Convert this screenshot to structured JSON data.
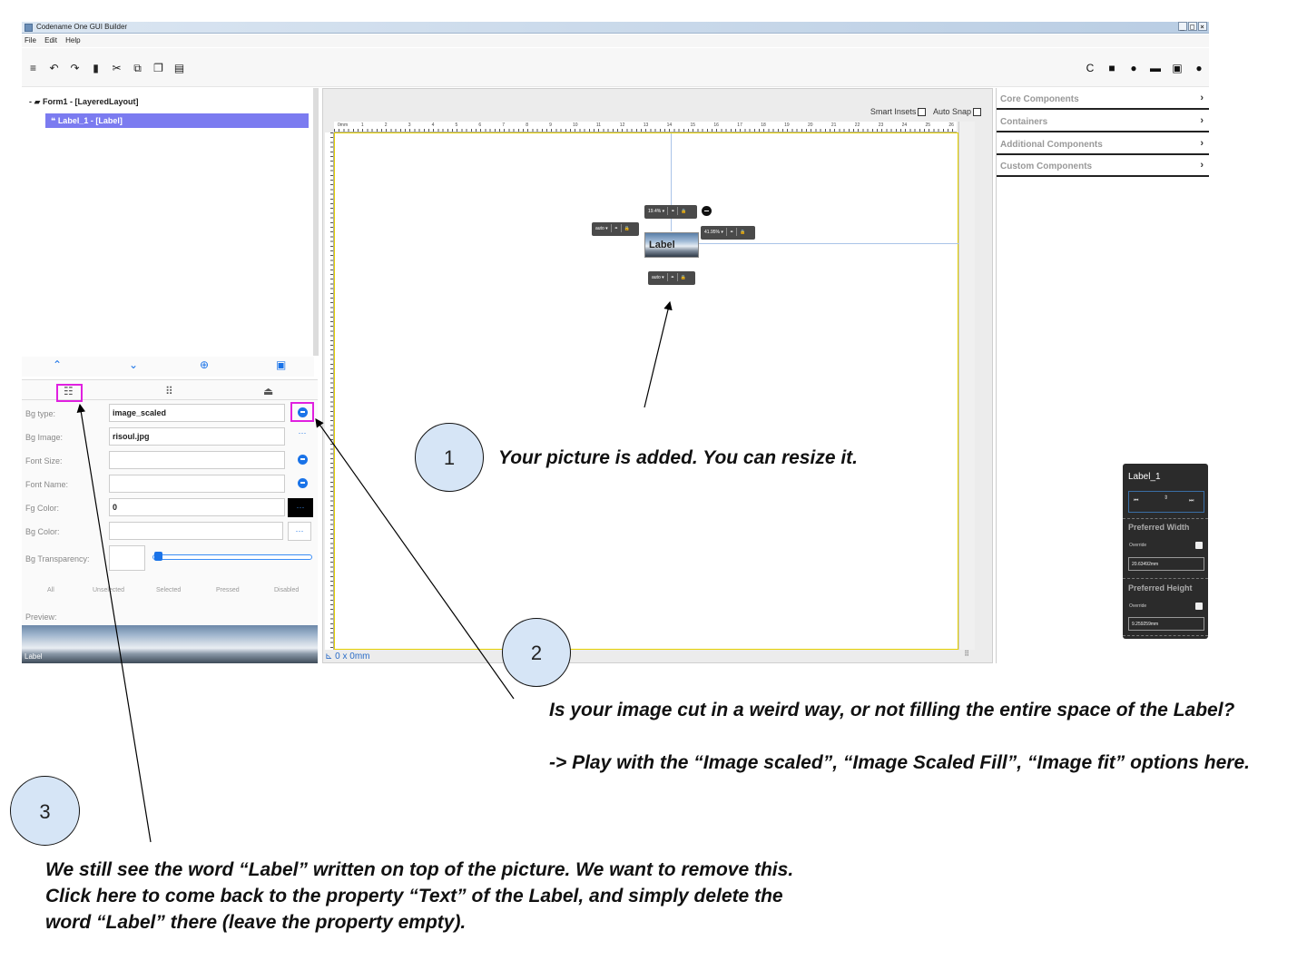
{
  "window": {
    "title": "Codename One GUI Builder",
    "controls": [
      "_",
      "□",
      "×"
    ]
  },
  "menu": [
    "File",
    "Edit",
    "Help"
  ],
  "toolbar": {
    "left_icons": [
      "menu-icon",
      "undo-icon",
      "redo-icon",
      "delete-icon",
      "cut-icon",
      "copy-icon",
      "paste-icon",
      "list-icon"
    ],
    "left_glyphs": [
      "≡",
      "↶",
      "↷",
      "▮",
      "✂",
      "⧉",
      "❐",
      "▤"
    ],
    "right_icons": [
      "refresh-icon",
      "preview-icon",
      "settings-icon",
      "export-icon",
      "save-icon",
      "run-icon"
    ],
    "right_glyphs": [
      "C",
      "■",
      "●",
      "▬",
      "▣",
      "●"
    ]
  },
  "tree": {
    "root_label": "Form1 - [LayeredLayout]",
    "child_label": "Label_1 - [Label]",
    "root_glyph": "-"
  },
  "nav": {
    "up": "⌃",
    "down": "⌄",
    "add": "⊕",
    "save": "▣"
  },
  "property_tabs": [
    "☷",
    "⠿",
    "⏏"
  ],
  "properties": [
    {
      "label": "Bg type:",
      "value": "image_scaled",
      "button": "circle"
    },
    {
      "label": "Bg Image:",
      "value": "risoul.jpg",
      "button": "···"
    },
    {
      "label": "Font Size:",
      "value": "",
      "button": "circle"
    },
    {
      "label": "Font Name:",
      "value": "",
      "button": "circle"
    },
    {
      "label": "Fg Color:",
      "value": "0",
      "button": "···"
    },
    {
      "label": "Bg Color:",
      "value": "",
      "button": "···"
    },
    {
      "label": "Bg Transparency:",
      "value": ""
    }
  ],
  "state_tabs": [
    "All",
    "Unselected",
    "Selected",
    "Pressed",
    "Disabled"
  ],
  "preview": {
    "title": "Preview:",
    "text": "Label"
  },
  "canvas": {
    "smart_insets": "Smart Insets",
    "auto_snap": "Auto Snap",
    "ruler_labels": [
      "0mm",
      "1",
      "2",
      "3",
      "4",
      "5",
      "6",
      "7",
      "8",
      "9",
      "10",
      "11",
      "12",
      "13",
      "14",
      "15",
      "16",
      "17",
      "18",
      "19",
      "20",
      "21",
      "22",
      "23",
      "24",
      "25",
      "26"
    ],
    "status": "0 x 0mm",
    "component_text": "Label",
    "inset_top": "19.4%",
    "inset_left": "auto",
    "inset_right": "41.95%",
    "inset_bottom": "auto",
    "corner_glyph": "⠿"
  },
  "palette": [
    {
      "label": "Core Components",
      "chevron": "›"
    },
    {
      "label": "Containers",
      "chevron": "›"
    },
    {
      "label": "Additional Components",
      "chevron": "›"
    },
    {
      "label": "Custom Components",
      "chevron": "›"
    }
  ],
  "layout_card": {
    "title": "Label_1",
    "preferred_width_label": "Preferred Width",
    "override": "Override",
    "preferred_width": "20.63492mm",
    "preferred_height_label": "Preferred Height",
    "preferred_height": "9.259259mm",
    "nav_glyphs": [
      "⏮",
      "⇕",
      "⏭"
    ]
  },
  "annotations": [
    {
      "number": "1",
      "text": "Your picture is added. You can resize it."
    },
    {
      "number": "2",
      "text": "Is your image cut in a weird way, or not filling the entire space of the Label?\n\n-> Play with the “Image scaled”, “Image Scaled Fill”, “Image fit” options here."
    },
    {
      "number": "3",
      "text": "We still see the word “Label” written on top of the picture. We want to remove this.\nClick here to come back to the property “Text” of the Label, and simply delete the word “Label” there (leave the property empty)."
    }
  ],
  "colors": {
    "accent": "#1a73e8",
    "selection": "#7b7bf0",
    "highlight": "#e020e0",
    "bubble": "#d6e5f6"
  }
}
